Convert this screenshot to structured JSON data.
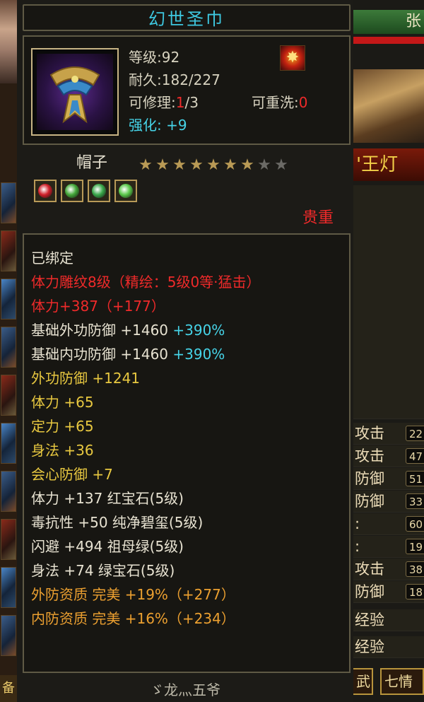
{
  "item": {
    "name": "幻世圣巾",
    "level_label": "等级",
    "level": "92",
    "durability_label": "耐久",
    "durability": "182/227",
    "repair_label": "可修理",
    "repair_used": "1",
    "repair_total": "/3",
    "rewash_label": "可重洗",
    "rewash_value": "0",
    "enhance_label": "强化:",
    "enhance_value": "+9",
    "type": "帽子",
    "stars_filled": 7,
    "stars_total": 9,
    "rarity": "贵重",
    "gem_colors": [
      "#d0202a",
      "#44a83a",
      "#3aa84a",
      "#5ac84a"
    ]
  },
  "attributes": [
    {
      "text": "已绑定",
      "color": "white"
    },
    {
      "text": "体力雕纹8级（精绘：5级0等·猛击）",
      "color": "red"
    },
    {
      "text": "体力+387（+177）",
      "color": "red"
    },
    {
      "text": "基础外功防御 +1460",
      "extra": " +390%",
      "color": "white"
    },
    {
      "text": "基础内功防御 +1460",
      "extra": " +390%",
      "color": "white"
    },
    {
      "text": "外功防御 +1241",
      "color": "yellow"
    },
    {
      "text": "体力 +65",
      "color": "yellow"
    },
    {
      "text": "定力 +65",
      "color": "yellow"
    },
    {
      "text": "身法 +36",
      "color": "yellow"
    },
    {
      "text": "会心防御 +7",
      "color": "yellow"
    },
    {
      "text": "体力 +137 红宝石(5级)",
      "color": "white"
    },
    {
      "text": "毒抗性 +50 纯净碧玺(5级)",
      "color": "white"
    },
    {
      "text": "闪避 +494 祖母绿(5级)",
      "color": "white"
    },
    {
      "text": "身法 +74 绿宝石(5级)",
      "color": "white"
    },
    {
      "text": "外防资质  完美 +19%（+277）",
      "color": "orange"
    },
    {
      "text": "内防资质  完美 +16%（+234）",
      "color": "orange"
    }
  ],
  "owner": "ゞ龙灬五爷",
  "background_panel": {
    "name_fragment": "张",
    "title_fragment": "'王灯",
    "rows": [
      {
        "label": "攻击",
        "value": "22"
      },
      {
        "label": "攻击",
        "value": "47"
      },
      {
        "label": "防御",
        "value": "51"
      },
      {
        "label": "防御",
        "value": "33"
      },
      {
        "label": ":",
        "value": "60"
      },
      {
        "label": ":",
        "value": "19"
      },
      {
        "label": "攻击",
        "value": "38"
      },
      {
        "label": "防御",
        "value": "18"
      },
      {
        "label": "经验",
        "value": ""
      },
      {
        "label": "经验",
        "value": ""
      }
    ],
    "tab_left": "武",
    "tab_right": "七情",
    "left_bottom": "备"
  }
}
